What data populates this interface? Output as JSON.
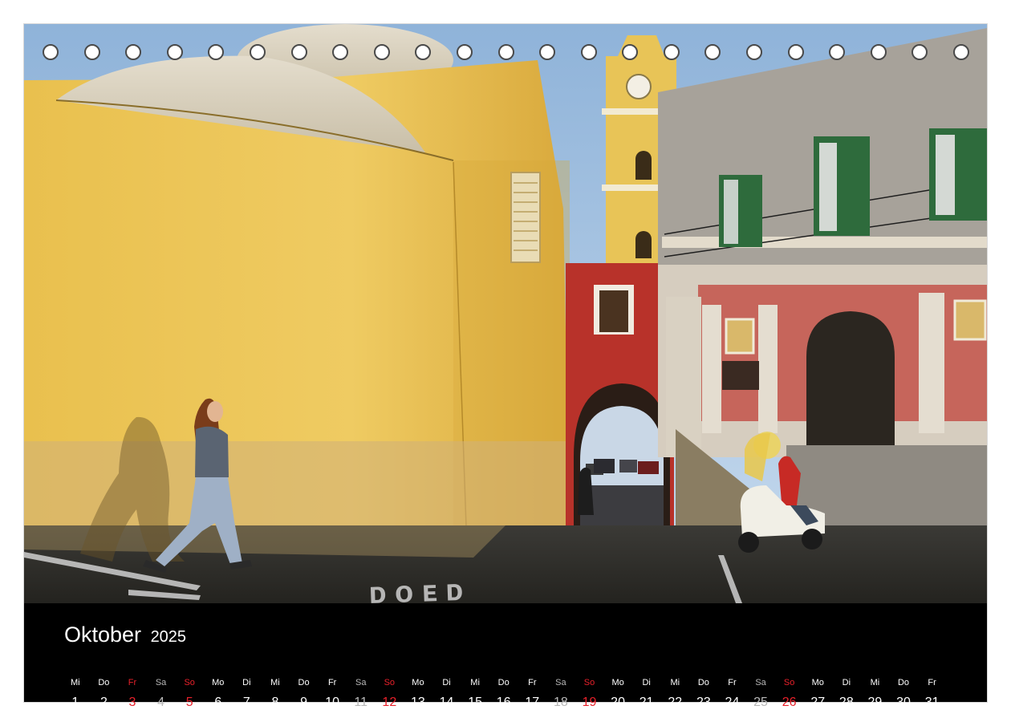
{
  "calendar": {
    "month": "Oktober",
    "year": "2025",
    "days": [
      {
        "weekday": "Mi",
        "day": "1",
        "type": "normal"
      },
      {
        "weekday": "Do",
        "day": "2",
        "type": "normal"
      },
      {
        "weekday": "Fr",
        "day": "3",
        "type": "holiday"
      },
      {
        "weekday": "Sa",
        "day": "4",
        "type": "saturday"
      },
      {
        "weekday": "So",
        "day": "5",
        "type": "sunday"
      },
      {
        "weekday": "Mo",
        "day": "6",
        "type": "normal"
      },
      {
        "weekday": "Di",
        "day": "7",
        "type": "normal"
      },
      {
        "weekday": "Mi",
        "day": "8",
        "type": "normal"
      },
      {
        "weekday": "Do",
        "day": "9",
        "type": "normal"
      },
      {
        "weekday": "Fr",
        "day": "10",
        "type": "normal"
      },
      {
        "weekday": "Sa",
        "day": "11",
        "type": "saturday"
      },
      {
        "weekday": "So",
        "day": "12",
        "type": "sunday"
      },
      {
        "weekday": "Mo",
        "day": "13",
        "type": "normal"
      },
      {
        "weekday": "Di",
        "day": "14",
        "type": "normal"
      },
      {
        "weekday": "Mi",
        "day": "15",
        "type": "normal"
      },
      {
        "weekday": "Do",
        "day": "16",
        "type": "normal"
      },
      {
        "weekday": "Fr",
        "day": "17",
        "type": "normal"
      },
      {
        "weekday": "Sa",
        "day": "18",
        "type": "saturday"
      },
      {
        "weekday": "So",
        "day": "19",
        "type": "sunday"
      },
      {
        "weekday": "Mo",
        "day": "20",
        "type": "normal"
      },
      {
        "weekday": "Di",
        "day": "21",
        "type": "normal"
      },
      {
        "weekday": "Mi",
        "day": "22",
        "type": "normal"
      },
      {
        "weekday": "Do",
        "day": "23",
        "type": "normal"
      },
      {
        "weekday": "Fr",
        "day": "24",
        "type": "normal"
      },
      {
        "weekday": "Sa",
        "day": "25",
        "type": "saturday"
      },
      {
        "weekday": "So",
        "day": "26",
        "type": "sunday"
      },
      {
        "weekday": "Mo",
        "day": "27",
        "type": "normal"
      },
      {
        "weekday": "Di",
        "day": "28",
        "type": "normal"
      },
      {
        "weekday": "Mi",
        "day": "29",
        "type": "normal"
      },
      {
        "weekday": "Do",
        "day": "30",
        "type": "normal"
      },
      {
        "weekday": "Fr",
        "day": "31",
        "type": "normal"
      }
    ]
  },
  "binding_holes": 23,
  "colors": {
    "sunday_holiday": "#e8202a",
    "saturday": "#b8b8b8",
    "calendar_bar": "#000000",
    "wall_yellow": "#e6b84a",
    "arch_red": "#b8322a"
  }
}
